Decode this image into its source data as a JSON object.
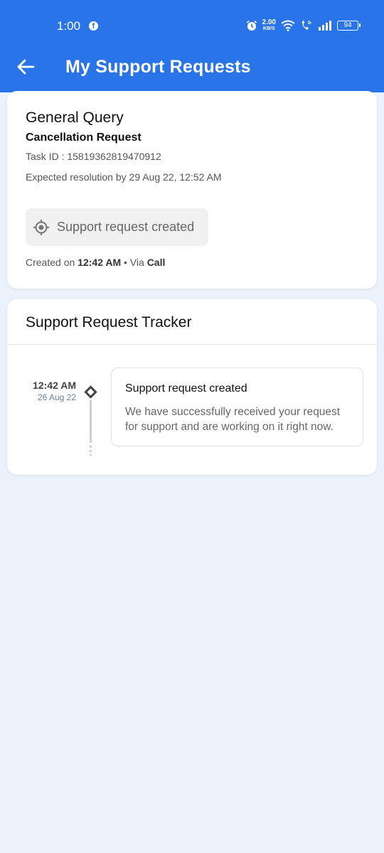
{
  "status_bar": {
    "time": "1:00",
    "speed_value": "2.00",
    "speed_unit": "KB/S",
    "battery": "94"
  },
  "app_bar": {
    "title": "My Support Requests"
  },
  "request": {
    "category": "General Query",
    "type": "Cancellation Request",
    "task_id": "Task ID : 15819362819470912",
    "expected": "Expected resolution by 29 Aug 22, 12:52 AM",
    "status": "Support request created",
    "created_prefix": "Created on ",
    "created_time": "12:42 AM",
    "via_prefix": " • Via ",
    "via_channel": "Call"
  },
  "tracker": {
    "title": "Support Request Tracker",
    "events": [
      {
        "time": "12:42 AM",
        "date": "26 Aug 22",
        "title": "Support request created",
        "description": "We have successfully received your request for support and are working on it right now."
      }
    ]
  },
  "colors": {
    "primary": "#2874e8",
    "background": "#eaf2fc"
  }
}
